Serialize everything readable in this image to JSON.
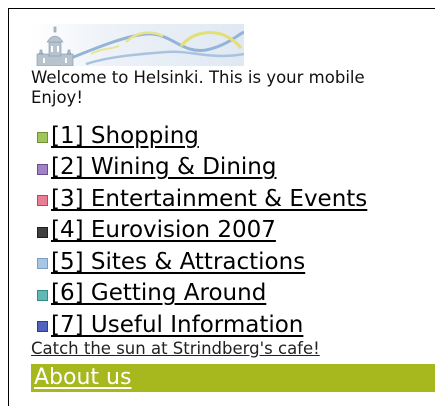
{
  "welcome": {
    "line1": "Welcome to Helsinki. This is your mobile",
    "line2": "Enjoy!"
  },
  "menu": [
    {
      "label": "[1] Shopping",
      "color": "#a2c55b",
      "border": "#6e9231"
    },
    {
      "label": "[2] Wining & Dining",
      "color": "#9f83c2",
      "border": "#6a4c92"
    },
    {
      "label": "[3] Entertainment & Events",
      "color": "#ea7d93",
      "border": "#b24a63"
    },
    {
      "label": "[4] Eurovision 2007",
      "color": "#3f3f3f",
      "border": "#202020"
    },
    {
      "label": "[5] Sites & Attractions",
      "color": "#a8c6e6",
      "border": "#7d9ec2"
    },
    {
      "label": "[6] Getting Around",
      "color": "#62b8b3",
      "border": "#348a86"
    },
    {
      "label": "[7] Useful Information",
      "color": "#4f62bd",
      "border": "#2c3d8c"
    }
  ],
  "promo": "Catch the sun at Strindberg's cafe!",
  "about": {
    "label": "About us",
    "background": "#a6b81e"
  }
}
